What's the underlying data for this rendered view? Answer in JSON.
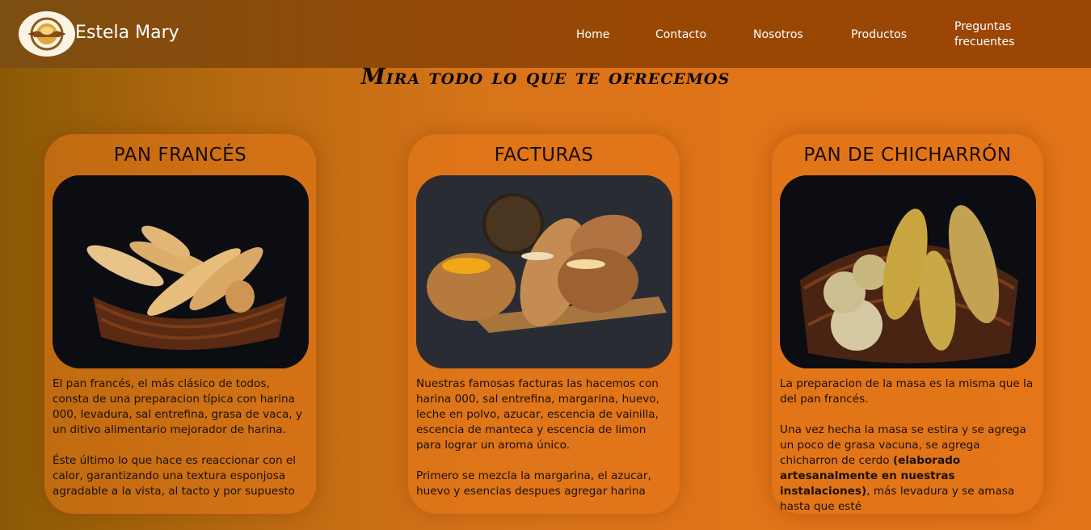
{
  "brand": {
    "name": "Estela Mary"
  },
  "nav": {
    "home": "Home",
    "contacto": "Contacto",
    "nosotros": "Nosotros",
    "productos": "Productos",
    "faq_line1": "Preguntas",
    "faq_line2": "frecuentes"
  },
  "headline": "Mira todo lo que te ofrecemos",
  "cards": [
    {
      "title": "PAN FRANCÉS",
      "p1": "El pan francés, el más clásico de todos, consta de una preparacion típica con harina 000, levadura, sal entrefina, grasa de vaca, y un ditivo alimentario mejorador de harina.",
      "p2": "Éste último lo que hace es reaccionar con el calor, garantizando una textura esponjosa agradable a la vista, al tacto y por supuesto"
    },
    {
      "title": "FACTURAS",
      "p1": "Nuestras famosas facturas las hacemos con harina 000, sal entrefina, margarina, huevo, leche en polvo, azucar, escencia de vainilla, escencia de manteca y escencia de limon para lograr un aroma único.",
      "p2": "Primero se mezcla la margarina, el azucar, huevo y esencias despues agregar harina"
    },
    {
      "title": "PAN DE CHICHARRÓN",
      "p1": "La preparacion de la masa es la misma que la del pan francés.",
      "p2a": "Una vez hecha la masa se estira y se agrega un poco de grasa vacuna, se agrega chicharron de cerdo ",
      "p2b": "(elaborado artesanalmente en nuestras instalaciones)",
      "p2c": ", más levadura y se amasa hasta que esté"
    }
  ],
  "colors": {
    "navbar": "#9a4704",
    "background": "#e27419",
    "text": "#1a1004"
  }
}
